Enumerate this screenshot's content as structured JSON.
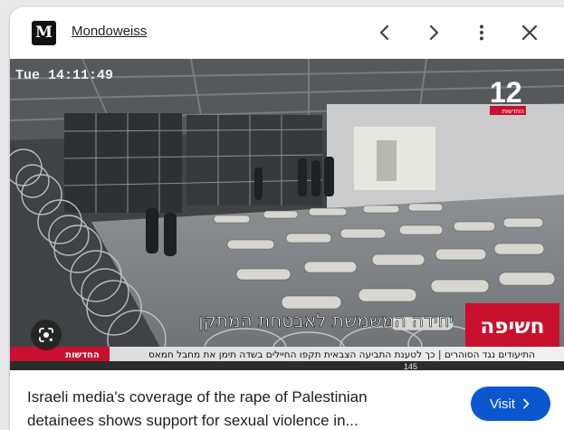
{
  "header": {
    "logo_letter": "M",
    "site_name": "Mondoweiss",
    "icons": [
      "chevron-left-icon",
      "chevron-right-icon",
      "more-vert-icon",
      "close-icon"
    ]
  },
  "media": {
    "timestamp": "Tue 14:11:49",
    "channel_number": "12",
    "channel_sub": "החדשות",
    "subtitle_he": "יחידה המשמשת לאבטחת המתקן",
    "badge_he": "חשיפה",
    "ticker_he": "התיעודים נגד הסוהרים | כך לטענת התביעה הצבאית תקפו החיילים בשדה תימן את מחבל חמאס",
    "ticker_logo": "החדשות",
    "corner_number": "145",
    "lens_icon": "google-lens-icon"
  },
  "caption": {
    "line1": "Israeli media's coverage of the rape of Palestinian",
    "line2": "detainees shows support for sexual violence in..."
  },
  "visit_button": {
    "label": "Visit",
    "icon": "chevron-right-icon"
  },
  "colors": {
    "accent": "#0b57d0",
    "badge_red": "#c8102e"
  }
}
